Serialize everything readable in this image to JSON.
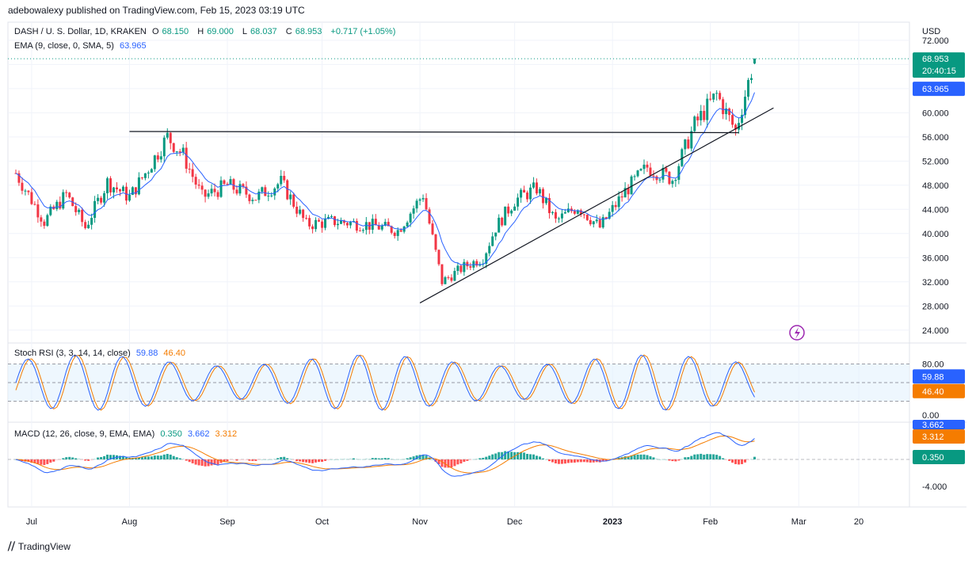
{
  "header": {
    "publisher_line": "adebowalexy published on TradingView.com, Feb 15, 2023 03:19 UTC"
  },
  "symbol": {
    "title": "DASH / U. S. Dollar, 1D, KRAKEN",
    "open_label": "O",
    "open": "68.150",
    "high_label": "H",
    "high": "69.000",
    "low_label": "L",
    "low": "68.037",
    "close_label": "C",
    "close": "68.953",
    "change": "+0.717 (+1.05%)"
  },
  "ema": {
    "label": "EMA (9, close, 0, SMA, 5)",
    "value": "63.965"
  },
  "stoch": {
    "label": "Stoch RSI (3, 3, 14, 14, close)",
    "k": "59.88",
    "d": "46.40"
  },
  "macd": {
    "label": "MACD (12, 26, close, 9, EMA, EMA)",
    "hist": "0.350",
    "macd": "3.662",
    "signal": "3.312"
  },
  "price_axis": {
    "currency": "USD",
    "ticks": [
      "72.000",
      "68.000",
      "64.000",
      "60.000",
      "56.000",
      "52.000",
      "48.000",
      "44.000",
      "40.000",
      "36.000",
      "32.000",
      "28.000",
      "24.000"
    ],
    "last_price": "68.953",
    "countdown": "20:40:15",
    "ema_tag": "63.965"
  },
  "stoch_axis": {
    "ticks": [
      "80.00",
      "0.00"
    ]
  },
  "macd_axis": {
    "ticks": [
      "-4.000"
    ]
  },
  "time_axis": [
    "Jul",
    "Aug",
    "Sep",
    "Oct",
    "Nov",
    "Dec",
    "2023",
    "Feb",
    "Mar",
    "20"
  ],
  "footer": {
    "brand": "TradingView"
  },
  "colors": {
    "up": "#089981",
    "down": "#f23645",
    "ema": "#2962ff",
    "stoch_k": "#2962ff",
    "stoch_d": "#f57c00",
    "macd": "#2962ff",
    "signal": "#f57c00"
  },
  "chart_data": {
    "type": "candlestick",
    "title": "DASH / U. S. Dollar, 1D, KRAKEN",
    "ylim": [
      22,
      75
    ],
    "y_label": "USD",
    "x_range": [
      "2023-06-25",
      "2023-03-20"
    ],
    "close_path": [
      {
        "date": "2022-06-26",
        "close": 50.0
      },
      {
        "date": "2022-07-05",
        "close": 42.0
      },
      {
        "date": "2022-07-12",
        "close": 46.5
      },
      {
        "date": "2022-07-18",
        "close": 41.0
      },
      {
        "date": "2022-07-25",
        "close": 48.5
      },
      {
        "date": "2022-08-01",
        "close": 46.0
      },
      {
        "date": "2022-08-06",
        "close": 50.0
      },
      {
        "date": "2022-08-13",
        "close": 56.0
      },
      {
        "date": "2022-08-18",
        "close": 53.0
      },
      {
        "date": "2022-08-24",
        "close": 46.0
      },
      {
        "date": "2022-09-01",
        "close": 48.0
      },
      {
        "date": "2022-09-10",
        "close": 46.0
      },
      {
        "date": "2022-09-18",
        "close": 48.5
      },
      {
        "date": "2022-09-26",
        "close": 41.5
      },
      {
        "date": "2022-10-05",
        "close": 42.0
      },
      {
        "date": "2022-10-15",
        "close": 41.5
      },
      {
        "date": "2022-10-25",
        "close": 40.5
      },
      {
        "date": "2022-11-02",
        "close": 46.5
      },
      {
        "date": "2022-11-08",
        "close": 32.0
      },
      {
        "date": "2022-11-15",
        "close": 34.5
      },
      {
        "date": "2022-11-21",
        "close": 36.0
      },
      {
        "date": "2022-11-25",
        "close": 41.0
      },
      {
        "date": "2022-12-01",
        "close": 45.5
      },
      {
        "date": "2022-12-08",
        "close": 47.5
      },
      {
        "date": "2022-12-14",
        "close": 42.0
      },
      {
        "date": "2022-12-21",
        "close": 44.5
      },
      {
        "date": "2022-12-28",
        "close": 41.0
      },
      {
        "date": "2023-01-05",
        "close": 47.0
      },
      {
        "date": "2023-01-12",
        "close": 51.0
      },
      {
        "date": "2023-01-20",
        "close": 49.0
      },
      {
        "date": "2023-01-27",
        "close": 58.0
      },
      {
        "date": "2023-02-03",
        "close": 63.0
      },
      {
        "date": "2023-02-09",
        "close": 57.0
      },
      {
        "date": "2023-02-12",
        "close": 63.0
      },
      {
        "date": "2023-02-15",
        "close": 68.953
      }
    ],
    "lines": [
      {
        "name": "horizontal",
        "from": {
          "date": "2022-08-01",
          "price": 56.9
        },
        "to": {
          "date": "2023-02-10",
          "price": 56.7
        }
      },
      {
        "name": "trendline",
        "from": {
          "date": "2022-11-01",
          "price": 28.5
        },
        "to": {
          "date": "2023-02-21",
          "price": 60.8
        }
      }
    ]
  }
}
